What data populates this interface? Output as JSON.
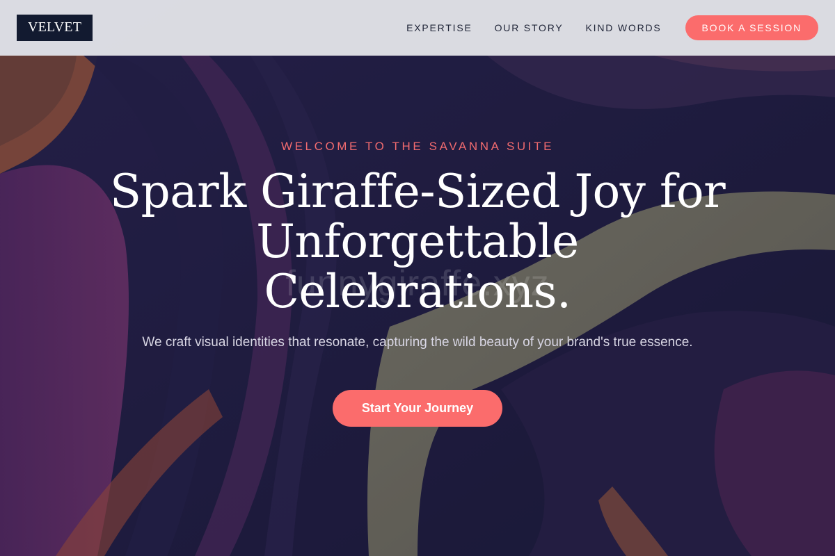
{
  "header": {
    "logo": "VELVET",
    "nav": [
      {
        "label": "EXPERTISE"
      },
      {
        "label": "OUR STORY"
      },
      {
        "label": "KIND WORDS"
      }
    ],
    "cta_label": "BOOK A SESSION"
  },
  "hero": {
    "eyebrow": "WELCOME TO THE SAVANNA SUITE",
    "headline": "Spark Giraffe-Sized Joy for Unforgettable Celebrations.",
    "watermark": "funnygiraffe.xyz",
    "subtitle": "We craft visual identities that resonate, capturing the wild beauty of your brand's true essence.",
    "cta_label": "Start Your Journey"
  },
  "colors": {
    "accent": "#fb6c6c",
    "eyebrow": "#f26b6f",
    "logo_bg": "#121a30",
    "header_bg": "#e2e3e8",
    "background": "#1d1c3c"
  }
}
